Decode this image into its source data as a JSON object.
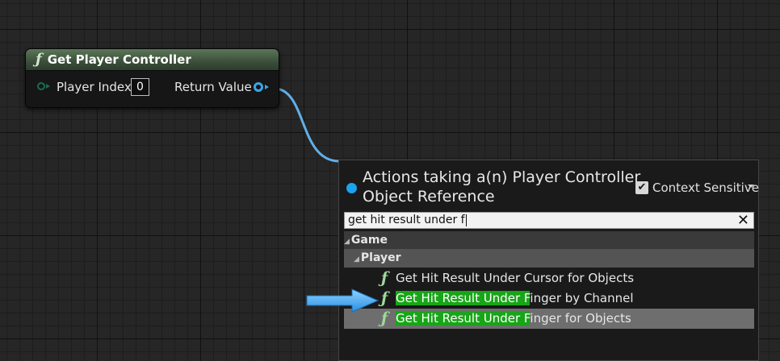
{
  "node": {
    "title": "Get Player Controller",
    "input_label": "Player Index",
    "input_value": "0",
    "output_label": "Return Value"
  },
  "menu": {
    "title_line1": "Actions taking a(n) Player Controller",
    "title_line2": "Object Reference",
    "context_sensitive_label": "Context Sensitive",
    "context_sensitive_checked": true,
    "search_value": "get hit result under f",
    "categories": {
      "game": "Game",
      "player": "Player"
    },
    "items": [
      {
        "highlight": "",
        "rest": "Get Hit Result Under Cursor for Objects"
      },
      {
        "highlight": "Get Hit Result Under F",
        "rest": "inger by Channel"
      },
      {
        "highlight": "Get Hit Result Under F",
        "rest": "inger for Objects"
      }
    ]
  },
  "colors": {
    "graph_bg": "#262626",
    "node_header": "#3b4f3a",
    "object_pin": "#3aa6e8",
    "exec_pin": "#1c6b53",
    "match_highlight": "#18a518",
    "selected_row": "#6e6e6e",
    "pointer_arrow": "#3aa6e8"
  },
  "icons": {
    "function": "function-icon",
    "pointer": "blue-arrow-pointer-icon"
  }
}
